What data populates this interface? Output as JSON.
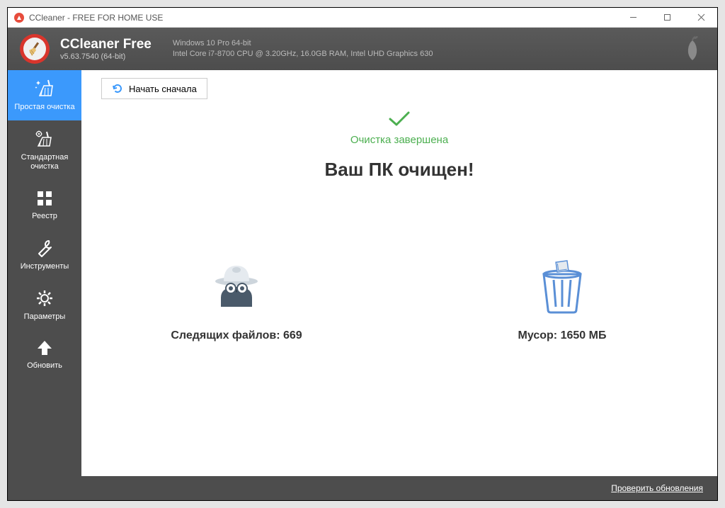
{
  "titlebar": {
    "text": "CCleaner - FREE FOR HOME USE"
  },
  "header": {
    "appName": "CCleaner Free",
    "version": "v5.63.7540 (64-bit)",
    "sysLine1": "Windows 10 Pro 64-bit",
    "sysLine2": "Intel Core i7-8700 CPU @ 3.20GHz, 16.0GB RAM, Intel UHD Graphics 630"
  },
  "sidebar": {
    "items": [
      {
        "label": "Простая очистка",
        "icon": "broom-sparkle"
      },
      {
        "label": "Стандартная очистка",
        "icon": "broom-gear"
      },
      {
        "label": "Реестр",
        "icon": "grid"
      },
      {
        "label": "Инструменты",
        "icon": "wrench"
      },
      {
        "label": "Параметры",
        "icon": "gear"
      },
      {
        "label": "Обновить",
        "icon": "arrow-up"
      }
    ]
  },
  "main": {
    "restartLabel": "Начать сначала",
    "statusText": "Очистка завершена",
    "headline": "Ваш ПК очищен!",
    "tracking": {
      "label": "Следящих файлов: 669",
      "count": 669
    },
    "junk": {
      "label": "Мусор: 1650 МБ",
      "sizeMB": 1650
    }
  },
  "footer": {
    "checkUpdates": "Проверить обновления"
  },
  "colors": {
    "accent": "#3b99fc",
    "success": "#4caf50",
    "darkPanel": "#4d4d4d"
  }
}
